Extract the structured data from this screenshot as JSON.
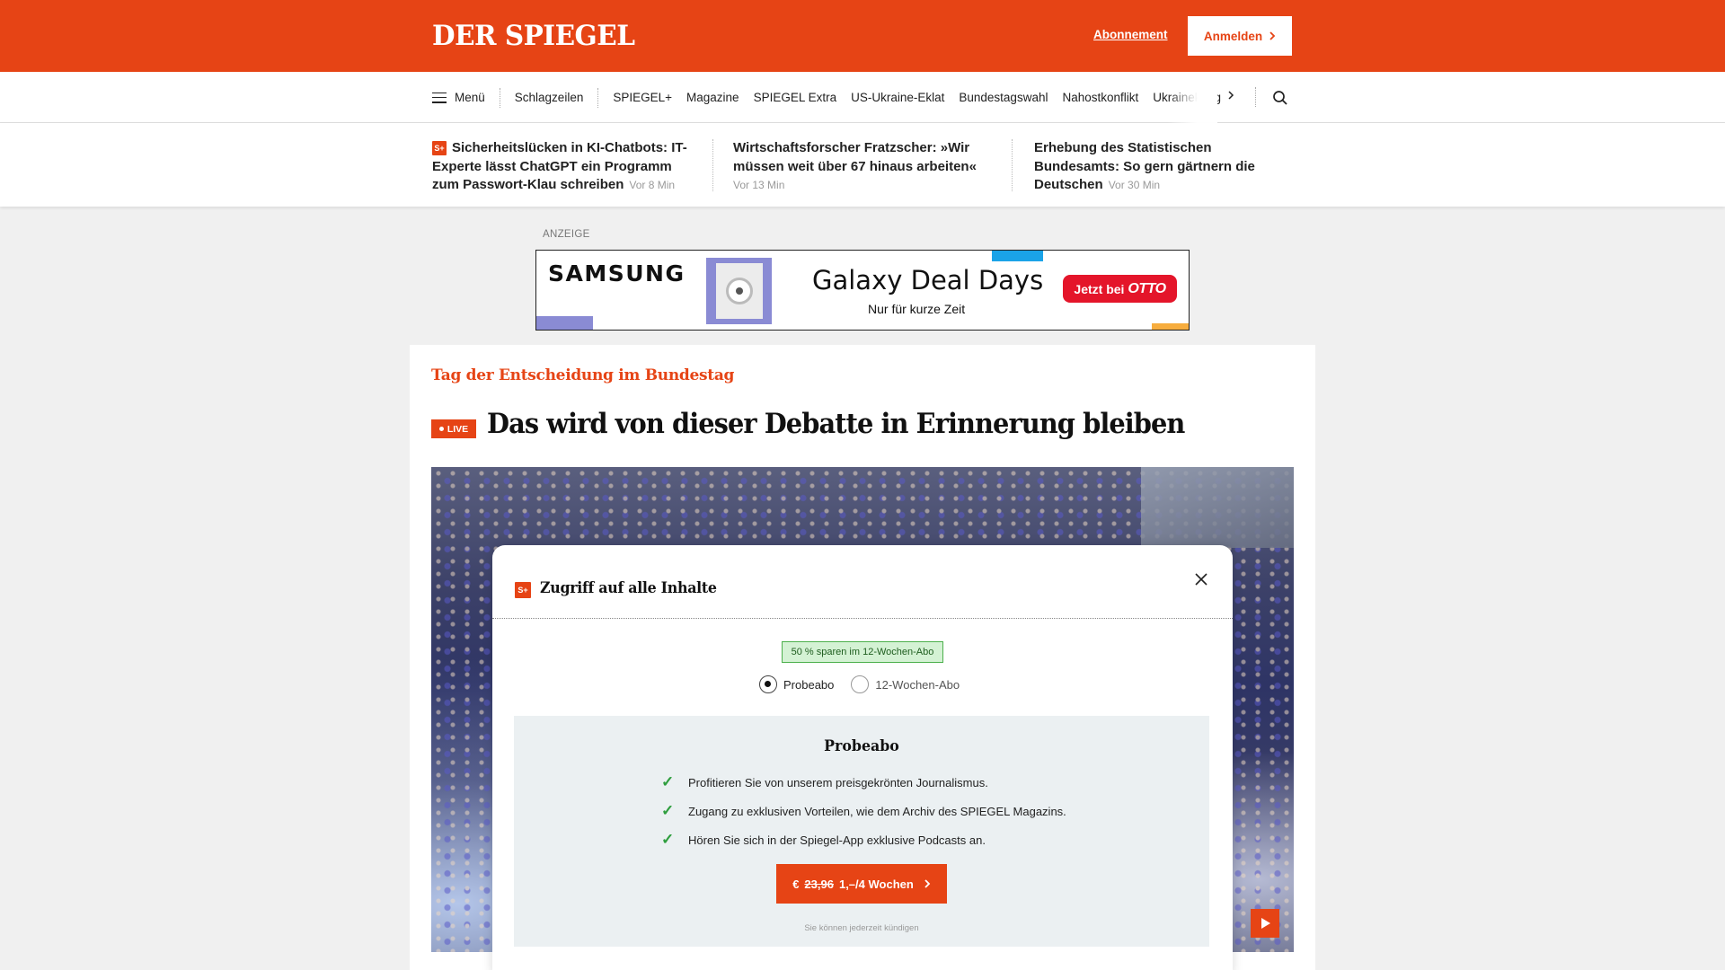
{
  "header": {
    "logo": "DER SPIEGEL",
    "abo_link": "Abonnement",
    "login_button": "Anmelden"
  },
  "nav": {
    "menu_label": "Menü",
    "items": [
      "Schlagzeilen",
      "SPIEGEL+",
      "Magazine",
      "SPIEGEL Extra",
      "US-Ukraine-Eklat",
      "Bundestagswahl",
      "Nahostkonflikt",
      "Ukrainekrieg"
    ]
  },
  "teasers": [
    {
      "badge": "S+",
      "title": "Sicherheitslücken in KI-Chatbots: IT-Experte lässt ChatGPT ein Programm zum Passwort-Klau schreiben",
      "time": "Vor 8 Min"
    },
    {
      "title": "Wirtschaftsforscher Fratzscher: »Wir müssen weit über 67 hinaus arbeiten«",
      "time": "Vor 13 Min"
    },
    {
      "title": "Erhebung des Statistischen Bundesamts: So gern gärtnern die Deutschen",
      "time": "Vor 30 Min"
    }
  ],
  "ad": {
    "label": "ANZEIGE",
    "brand": "SAMSUNG",
    "title": "Galaxy Deal Days",
    "subtitle": "Nur für kurze Zeit",
    "cta_prefix": "Jetzt bei",
    "cta_brand": "OTTO"
  },
  "article": {
    "kicker": "Tag der Entscheidung im Bundestag",
    "live_badge": "LIVE",
    "headline": "Das wird von dieser Debatte in Erinnerung bleiben"
  },
  "modal": {
    "badge": "S+",
    "title": "Zugriff auf alle Inhalte",
    "save_badge": "50 % sparen im 12-Wochen-Abo",
    "options": [
      "Probeabo",
      "12-Wochen-Abo"
    ],
    "selected_option": "Probeabo",
    "offer_title": "Probeabo",
    "benefits": [
      "Profitieren Sie von unserem preisgekrönten Journalismus.",
      "Zugang zu exklusiven Vorteilen, wie dem Archiv des SPIEGEL Magazins.",
      "Hören Sie sich in der Spiegel-App exklusive Podcasts an."
    ],
    "cta_currency": "€",
    "cta_old_price": "23,96",
    "cta_new_price": "1,–/4 Wochen",
    "cancel_note": "Sie können jederzeit kündigen"
  },
  "colors": {
    "brand": "#e64415",
    "ad_cta": "#e4152a",
    "check": "#2e9e3e",
    "save_badge_bg": "#d4f2d4"
  },
  "icons": [
    "hamburger-menu-icon",
    "chevron-right-icon",
    "search-icon",
    "close-icon",
    "check-icon",
    "play-icon"
  ]
}
